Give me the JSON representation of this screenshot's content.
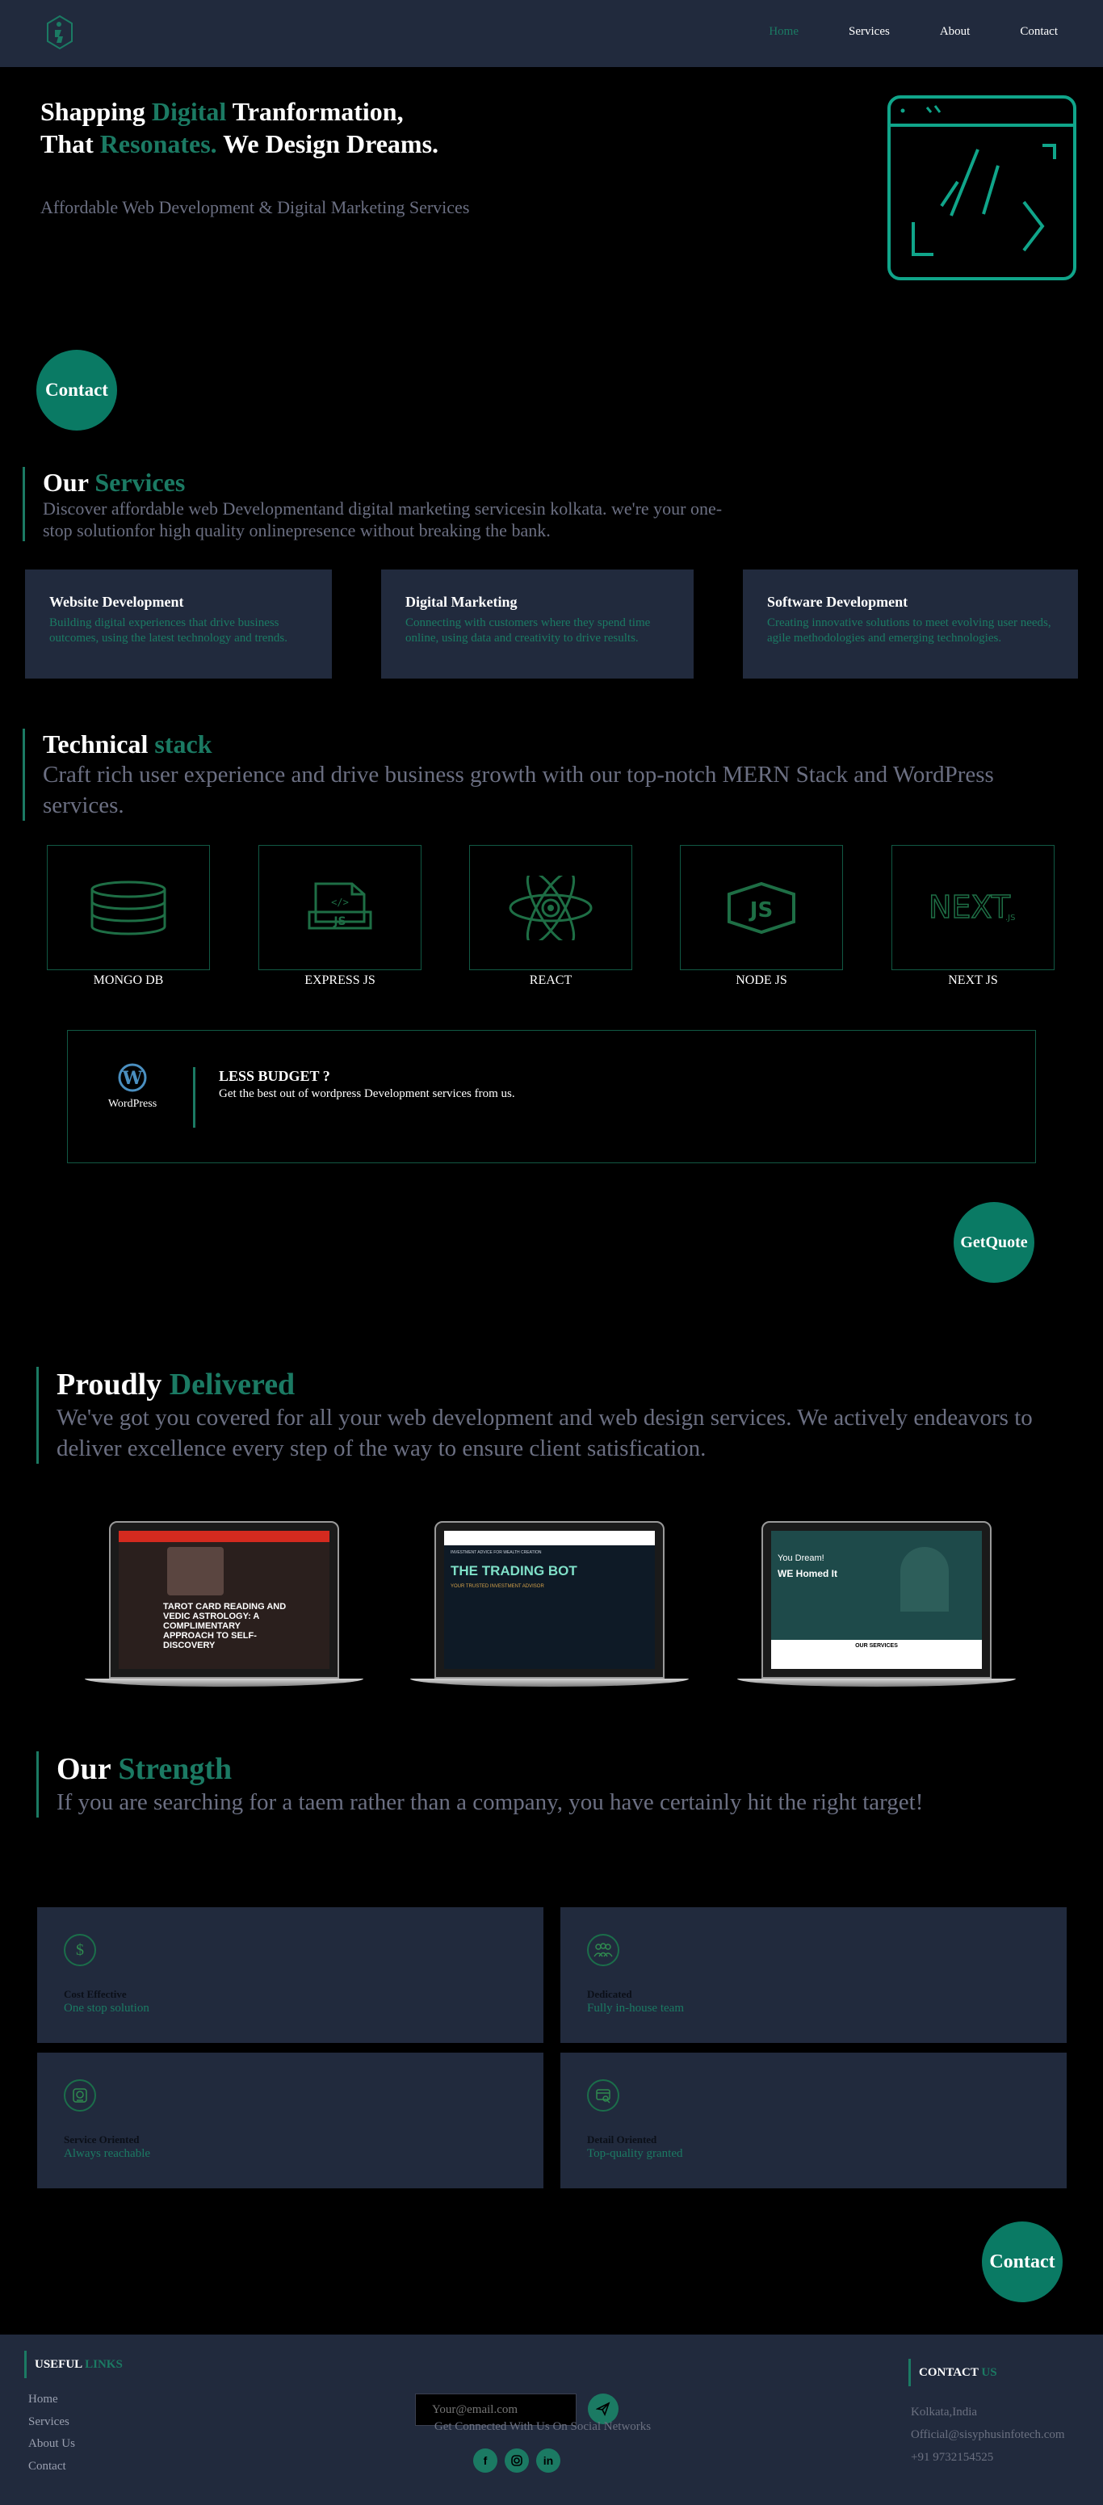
{
  "nav": {
    "items": [
      {
        "label": "Home",
        "active": true
      },
      {
        "label": "Services",
        "active": false
      },
      {
        "label": "About",
        "active": false
      },
      {
        "label": "Contact",
        "active": false
      }
    ]
  },
  "hero": {
    "title_line1_a": "Shapping ",
    "title_line1_b": "Digital",
    "title_line1_c": " Tranformation,",
    "title_line2_a": "That ",
    "title_line2_b": "Resonates.",
    "title_line2_c": " We Design Dreams.",
    "subtitle": "Affordable Web Development & Digital Marketing Services",
    "contact_button": "Contact"
  },
  "services": {
    "heading_a": "Our ",
    "heading_b": "Services",
    "description": "Discover affordable web Developmentand digital marketing servicesin kolkata. we're your one-stop solutionfor high quality onlinepresence without breaking the bank.",
    "cards": [
      {
        "title": "Website Development",
        "text": "Building digital experiences that drive business outcomes, using the latest technology and trends."
      },
      {
        "title": "Digital Marketing",
        "text": "Connecting with customers where they spend time online, using data and creativity to drive results."
      },
      {
        "title": "Software Development",
        "text": "Creating innovative solutions to meet evolving user needs, agile methodologies and emerging technologies."
      }
    ]
  },
  "tech": {
    "heading_a": "Technical ",
    "heading_b": "stack",
    "description": "Craft rich user experience and drive business growth with our top-notch MERN Stack and WordPress services.",
    "items": [
      {
        "label": "MONGO DB",
        "icon": "database-icon"
      },
      {
        "label": "EXPRESS JS",
        "icon": "js-file-icon"
      },
      {
        "label": "REACT",
        "icon": "atom-icon"
      },
      {
        "label": "NODE JS",
        "icon": "nodejs-icon"
      },
      {
        "label": "NEXT JS",
        "icon": "nextjs-icon"
      }
    ],
    "wordpress": {
      "logo_label": "WordPress",
      "title": "LESS BUDGET ?",
      "subtitle": "Get the best out of wordpress Development services from us."
    },
    "quote_button_line1": "Get",
    "quote_button_line2": "Quote"
  },
  "portfolio": {
    "heading_a": "Proudly ",
    "heading_b": "Delivered",
    "description": "We've got you covered for all your web development and web design services. We actively endeavors to deliver excellence every step of the way to ensure client satisfication.",
    "projects": [
      {
        "headline": "TAROT CARD READING AND VEDIC ASTROLOGY: A COMPLIMENTARY APPROACH TO SELF-DISCOVERY"
      },
      {
        "kicker": "INVESTMENT ADVICE FOR WEALTH CREATION",
        "headline": "THE TRADING BOT",
        "tagline": "YOUR TRUSTED INVESTMENT ADVISOR"
      },
      {
        "headline_a": "You Dream!",
        "headline_b": "WE Homed It",
        "section": "OUR SERVICES"
      }
    ]
  },
  "strength": {
    "heading_a": "Our ",
    "heading_b": "Strength",
    "description": "If you are searching for a taem rather than a company, you have certainly hit the right target!",
    "cards": [
      {
        "title": "Cost Effective",
        "subtitle": "One stop solution",
        "icon": "dollar-icon"
      },
      {
        "title": "Dedicated",
        "subtitle": "Fully in-house team",
        "icon": "team-icon"
      },
      {
        "title": "Service Oriented",
        "subtitle": "Always reachable",
        "icon": "support-icon"
      },
      {
        "title": "Detail Oriented",
        "subtitle": "Top-quality granted",
        "icon": "detail-icon"
      }
    ],
    "contact_button": "Contact"
  },
  "footer": {
    "links_heading_a": "USEFUL ",
    "links_heading_b": "LINKS",
    "links": [
      "Home",
      "Services",
      "About Us",
      "Contact"
    ],
    "email_placeholder": "Your@email.com",
    "social_text": "Get Connected With Us On Social Networks",
    "contact_heading_a": "CONTACT ",
    "contact_heading_b": "US",
    "location": "Kolkata,India",
    "email": "Official@sisyphusinfotech.com",
    "phone": "+91 9732154525"
  },
  "colors": {
    "accent": "#1b7a63",
    "card_bg": "#212a3d",
    "button": "#0a7a64"
  }
}
